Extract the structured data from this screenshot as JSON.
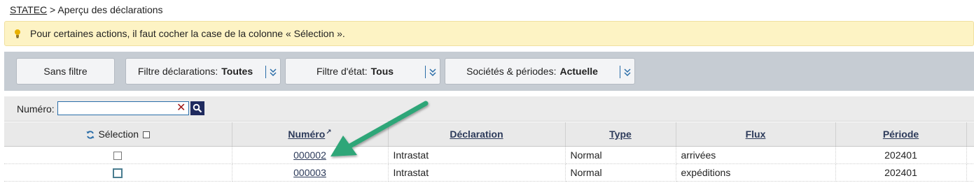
{
  "breadcrumb": {
    "root": "STATEC",
    "separator": ">",
    "current": "Aperçu des déclarations"
  },
  "info": {
    "message": "Pour certaines actions, il faut cocher la case de la colonne « Sélection »."
  },
  "filters": {
    "no_filter": "Sans filtre",
    "declarations": {
      "label": "Filtre déclarations:",
      "value": "Toutes"
    },
    "state": {
      "label": "Filtre d'état:",
      "value": "Tous"
    },
    "companies": {
      "label": "Sociétés & périodes:",
      "value": "Actuelle"
    }
  },
  "search": {
    "label": "Numéro:",
    "value": "",
    "clear_icon": "✕"
  },
  "table": {
    "columns": {
      "selection": "Sélection",
      "numero": "Numéro",
      "numero_sort": "↗",
      "declaration": "Déclaration",
      "type": "Type",
      "flux": "Flux",
      "periode": "Période"
    },
    "rows": [
      {
        "numero": "000002",
        "declaration": "Intrastat",
        "type": "Normal",
        "flux": "arrivées",
        "periode": "202401",
        "selected": false
      },
      {
        "numero": "000003",
        "declaration": "Intrastat",
        "type": "Normal",
        "flux": "expéditions",
        "periode": "202401",
        "selected": false
      }
    ]
  },
  "colors": {
    "accent": "#2a6da8",
    "info_bg": "#fdf3c4",
    "filter_bg": "#c6ccd3",
    "arrow": "#2fa678",
    "header_text": "#2c3a5a"
  },
  "icons": {
    "bulb": "lightbulb-icon",
    "search": "search-icon",
    "refresh": "refresh-icon",
    "arrow": "annotation-arrow",
    "chevron": "chevron-down-icon"
  }
}
